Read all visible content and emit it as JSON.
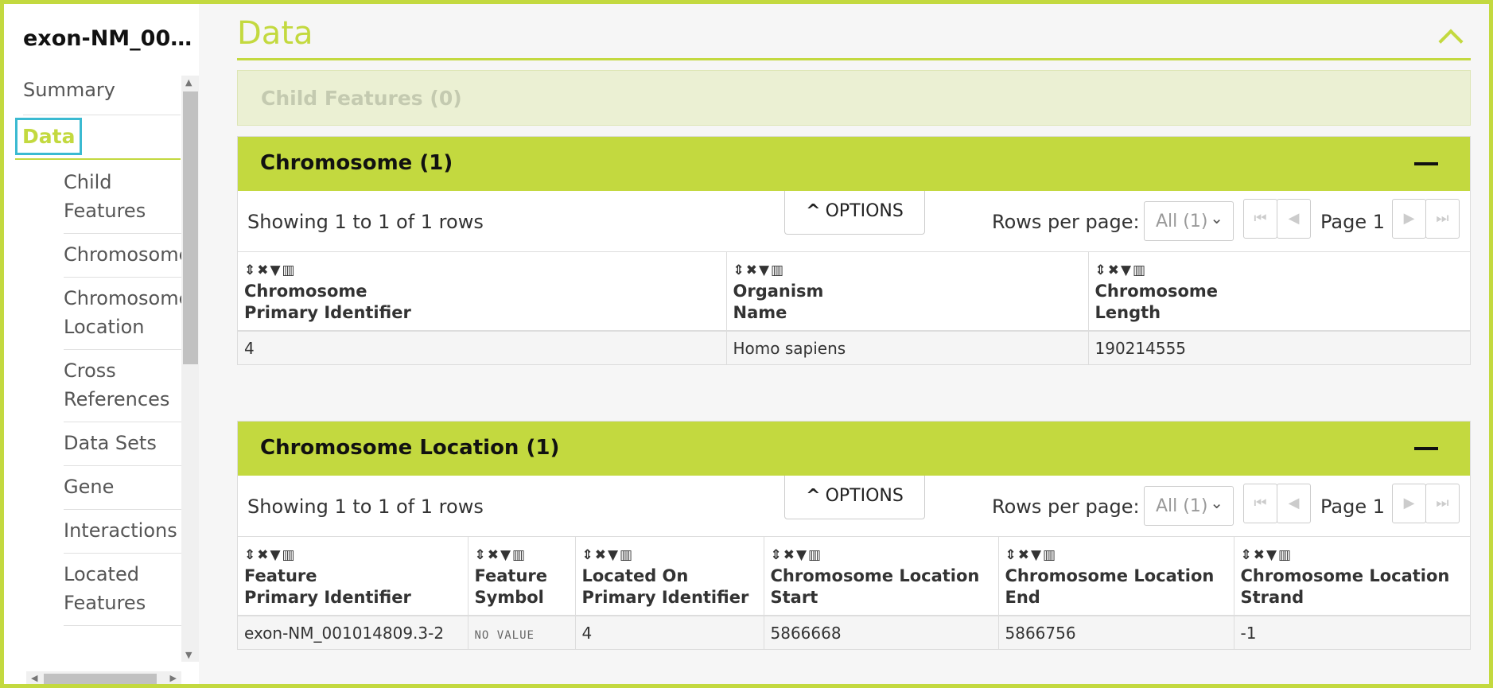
{
  "sidebar": {
    "title": "exon-NM_001...",
    "items": [
      {
        "label": "Summary"
      },
      {
        "label": "Data"
      },
      {
        "label": "Child Features"
      },
      {
        "label": "Chromosome"
      },
      {
        "label": "Chromosome Location"
      },
      {
        "label": "Cross References"
      },
      {
        "label": "Data Sets"
      },
      {
        "label": "Gene"
      },
      {
        "label": "Interactions"
      },
      {
        "label": "Located Features"
      }
    ]
  },
  "section": {
    "title": "Data",
    "child_features": "Child Features (0)"
  },
  "chromosome_table": {
    "title": "Chromosome (1)",
    "showing": "Showing 1 to 1 of 1 rows",
    "options_label": "OPTIONS",
    "rows_per_page_label": "Rows per page:",
    "rows_per_page_value": "All (1)",
    "page_label": "Page 1",
    "columns": [
      {
        "line1": "Chromosome",
        "line2": "Primary Identifier"
      },
      {
        "line1": "Organism",
        "line2": "Name"
      },
      {
        "line1": "Chromosome",
        "line2": "Length"
      }
    ],
    "rows": [
      [
        "4",
        "Homo sapiens",
        "190214555"
      ]
    ]
  },
  "location_table": {
    "title": "Chromosome Location (1)",
    "showing": "Showing 1 to 1 of 1 rows",
    "options_label": "OPTIONS",
    "rows_per_page_label": "Rows per page:",
    "rows_per_page_value": "All (1)",
    "page_label": "Page 1",
    "columns": [
      {
        "line1": "Feature",
        "line2": "Primary Identifier"
      },
      {
        "line1": "Feature",
        "line2": "Symbol"
      },
      {
        "line1": "Located On",
        "line2": "Primary Identifier"
      },
      {
        "line1": "Chromosome Location",
        "line2": "Start"
      },
      {
        "line1": "Chromosome Location",
        "line2": "End"
      },
      {
        "line1": "Chromosome Location",
        "line2": "Strand"
      }
    ],
    "rows": [
      [
        "exon-NM_001014809.3-2",
        "NO VALUE",
        "4",
        "5866668",
        "5866756",
        "-1"
      ]
    ]
  },
  "colors": {
    "accent": "#c3d93f",
    "focus": "#3bbad1"
  }
}
